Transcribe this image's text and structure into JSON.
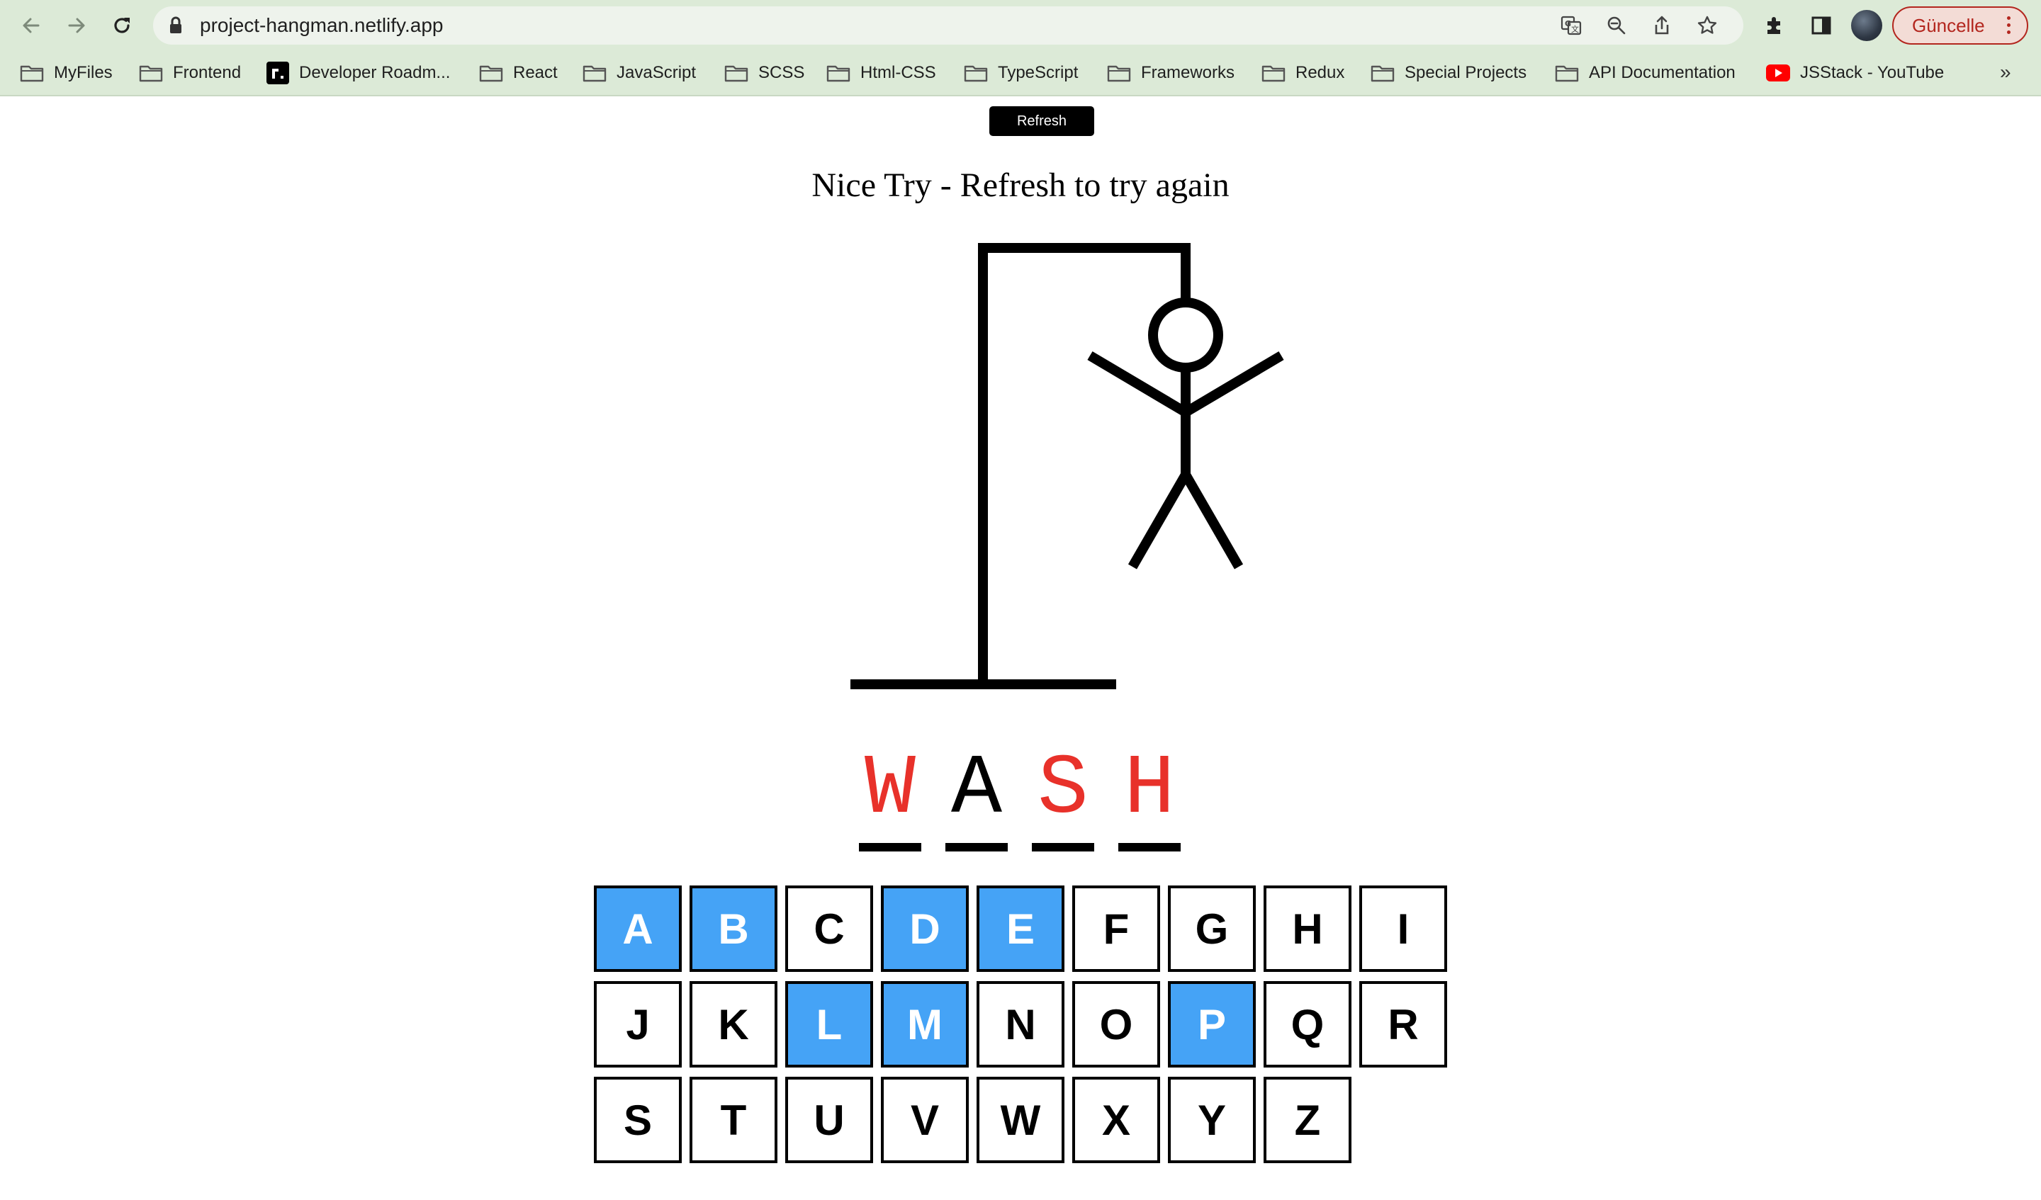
{
  "browser": {
    "url": "project-hangman.netlify.app",
    "update_label": "Güncelle",
    "bookmarks": [
      {
        "label": "MyFiles",
        "icon": "folder-icon"
      },
      {
        "label": "Frontend",
        "icon": "folder-icon"
      },
      {
        "label": "Developer Roadm...",
        "icon": "roadmap-logo-icon"
      },
      {
        "label": "React",
        "icon": "folder-icon"
      },
      {
        "label": "JavaScript",
        "icon": "folder-icon"
      },
      {
        "label": "SCSS",
        "icon": "folder-icon"
      },
      {
        "label": "Html-CSS",
        "icon": "folder-icon"
      },
      {
        "label": "TypeScript",
        "icon": "folder-icon"
      },
      {
        "label": "Frameworks",
        "icon": "folder-icon"
      },
      {
        "label": "Redux",
        "icon": "folder-icon"
      },
      {
        "label": "Special Projects",
        "icon": "folder-icon"
      },
      {
        "label": "API Documentation",
        "icon": "folder-icon"
      },
      {
        "label": "JSStack - YouTube",
        "icon": "youtube-icon"
      }
    ],
    "bookmarks_overflow": "»"
  },
  "game": {
    "refresh_label": "Refresh",
    "status": "Nice Try - Refresh to try again",
    "word": [
      {
        "char": "W",
        "color": "#e8312a"
      },
      {
        "char": "A",
        "color": "#000000"
      },
      {
        "char": "S",
        "color": "#e8312a"
      },
      {
        "char": "H",
        "color": "#e8312a"
      }
    ],
    "used_color": "#45a3f6",
    "keys": [
      {
        "char": "A",
        "used": true
      },
      {
        "char": "B",
        "used": true
      },
      {
        "char": "C",
        "used": false
      },
      {
        "char": "D",
        "used": true
      },
      {
        "char": "E",
        "used": true
      },
      {
        "char": "F",
        "used": false
      },
      {
        "char": "G",
        "used": false
      },
      {
        "char": "H",
        "used": false
      },
      {
        "char": "I",
        "used": false
      },
      {
        "char": "J",
        "used": false
      },
      {
        "char": "K",
        "used": false
      },
      {
        "char": "L",
        "used": true
      },
      {
        "char": "M",
        "used": true
      },
      {
        "char": "N",
        "used": false
      },
      {
        "char": "O",
        "used": false
      },
      {
        "char": "P",
        "used": true
      },
      {
        "char": "Q",
        "used": false
      },
      {
        "char": "R",
        "used": false
      },
      {
        "char": "S",
        "used": false
      },
      {
        "char": "T",
        "used": false
      },
      {
        "char": "U",
        "used": false
      },
      {
        "char": "V",
        "used": false
      },
      {
        "char": "W",
        "used": false
      },
      {
        "char": "X",
        "used": false
      },
      {
        "char": "Y",
        "used": false
      },
      {
        "char": "Z",
        "used": false
      }
    ]
  }
}
